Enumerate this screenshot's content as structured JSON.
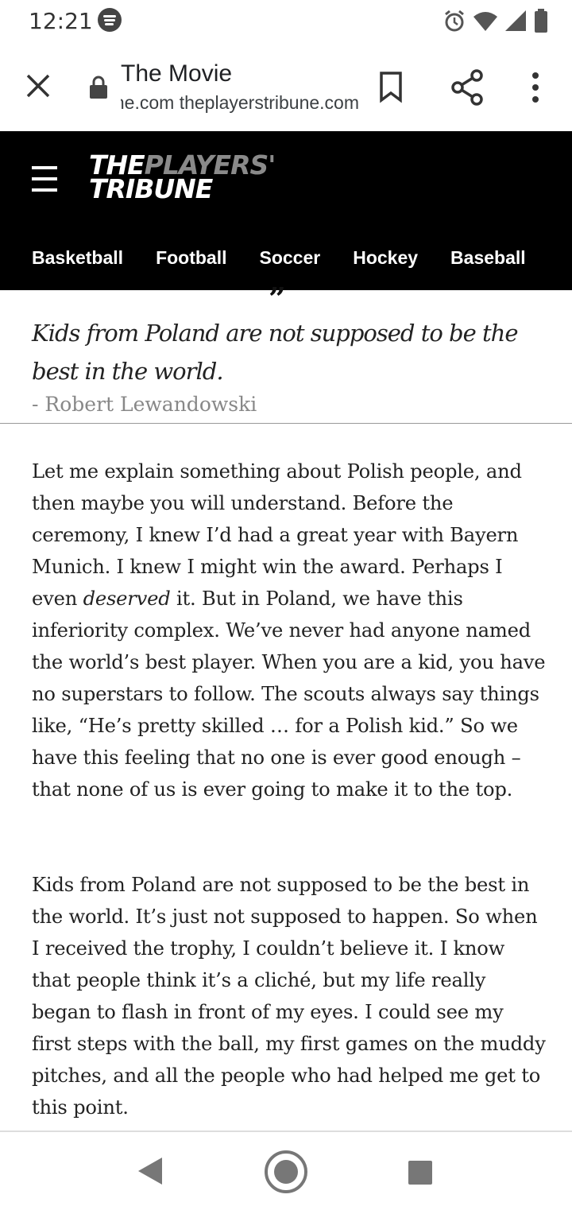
{
  "status_bar": {
    "time": "12:21"
  },
  "toolbar": {
    "title": "The Movie",
    "url": "theplayerstribune.com theplayerstribune.com"
  },
  "site": {
    "logo_line1_white": "THE",
    "logo_line1_gray": "PLAYERS'",
    "logo_line2": "TRIBUNE",
    "nav": [
      "Basketball",
      "Football",
      "Soccer",
      "Hockey",
      "Baseball"
    ]
  },
  "article": {
    "pull_quote": "Kids from Poland are not supposed to be the best in the world.",
    "attribution": "- Robert Lewandowski",
    "p1_before": "Let me explain something about Polish people, and then maybe you will understand. Before the ceremony, I knew I’d had a great year with Bayern Munich. I knew I might win the award. Perhaps I even ",
    "p1_em": "deserved",
    "p1_after": " it. But in Poland, we have this inferiority complex. We’ve never had anyone named the world’s best player. When you are a kid, you have no superstars to follow. The scouts always say things like, “He’s pretty skilled … for a Polish kid.” So we have this feeling that no one is ever good enough – that none of us is ever going to make it to the top.",
    "p2": "Kids from Poland are not supposed to be the best in the world. It’s just not supposed to happen. So when I received the trophy, I couldn’t believe it. I know that people think it’s a cliché, but my life really began to flash in front of my eyes. I could see my first steps with the ball, my first games on the muddy pitches, and all the people who had helped me get to this point."
  },
  "icons": {
    "close": "close-icon",
    "lock": "lock-icon",
    "bookmark": "bookmark-icon",
    "share": "share-icon",
    "more": "more-vert-icon",
    "menu": "hamburger-icon"
  },
  "colors": {
    "header_bg": "#000000",
    "logo_gray": "#8a8a8a"
  }
}
